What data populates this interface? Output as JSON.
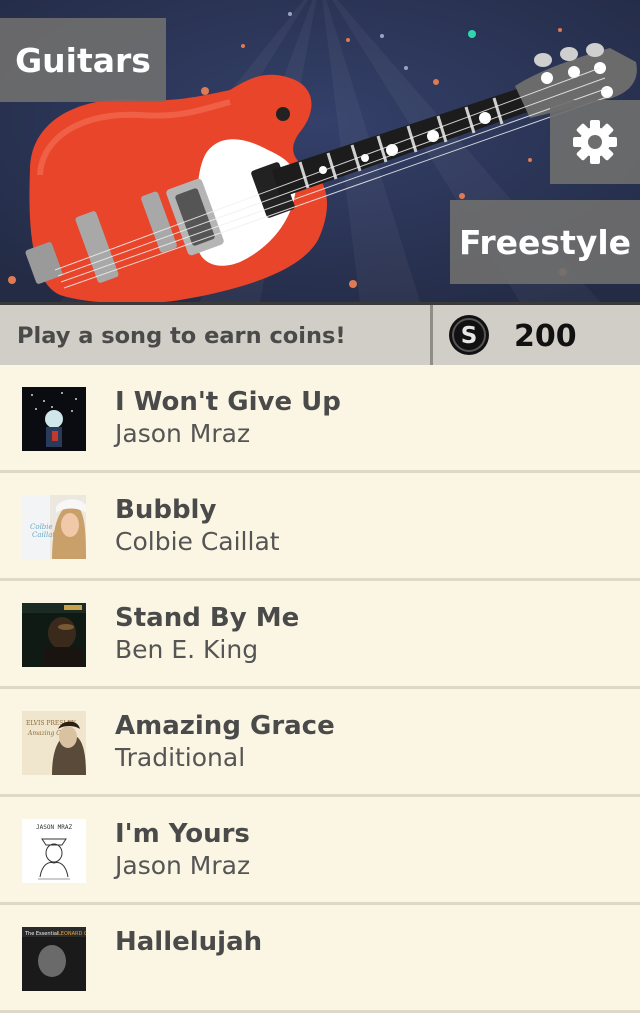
{
  "header": {
    "guitars_label": "Guitars",
    "freestyle_label": "Freestyle",
    "settings_icon": "gear-icon",
    "hero_image": "red-electric-guitar"
  },
  "status": {
    "message": "Play a song to earn coins!",
    "coin_icon": "coin-s-icon",
    "coin_symbol": "S",
    "coins": "200"
  },
  "songs": [
    {
      "title": "I Won't Give Up",
      "artist": "Jason Mraz"
    },
    {
      "title": "Bubbly",
      "artist": "Colbie Caillat"
    },
    {
      "title": "Stand By Me",
      "artist": "Ben E. King"
    },
    {
      "title": "Amazing Grace",
      "artist": "Traditional"
    },
    {
      "title": "I'm Yours",
      "artist": "Jason Mraz"
    },
    {
      "title": "Hallelujah",
      "artist": ""
    }
  ],
  "colors": {
    "hero_bg": "#2a3452",
    "guitar_body": "#e8452a",
    "list_bg": "#fbf6e3",
    "button_bg": "#6e6e6e"
  }
}
